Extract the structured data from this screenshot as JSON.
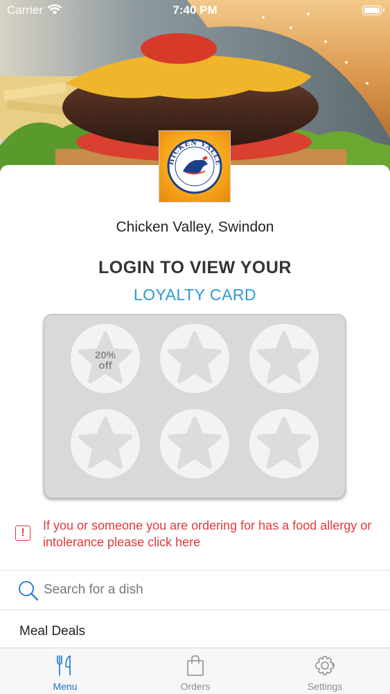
{
  "status_bar": {
    "carrier": "Carrier",
    "time": "7:40 PM"
  },
  "restaurant": {
    "name": "Chicken Valley, Swindon",
    "logo_text": "CHICKEN VALLEY"
  },
  "loyalty": {
    "heading_line1": "LOGIN TO VIEW YOUR",
    "heading_line2": "LOYALTY CARD",
    "stamps": [
      {
        "label": "20% off"
      },
      {
        "label": ""
      },
      {
        "label": ""
      },
      {
        "label": ""
      },
      {
        "label": ""
      },
      {
        "label": ""
      }
    ],
    "reward_line1": "20%",
    "reward_line2": "off"
  },
  "allergy": {
    "text": "If you or someone you are ordering for has a food allergy or intolerance please click here"
  },
  "search": {
    "placeholder": "Search for a dish"
  },
  "menu": {
    "categories": [
      "Meal Deals"
    ]
  },
  "tabs": [
    {
      "label": "Menu",
      "icon": "fork-knife-icon",
      "active": true
    },
    {
      "label": "Orders",
      "icon": "shopping-bag-icon",
      "active": false
    },
    {
      "label": "Settings",
      "icon": "gear-icon",
      "active": false
    }
  ],
  "colors": {
    "accent": "#2a9ad6",
    "tab_active": "#1a73c9",
    "tab_inactive": "#8e8e93",
    "alert": "#e03a3a",
    "card_bg": "#d9d9db"
  }
}
